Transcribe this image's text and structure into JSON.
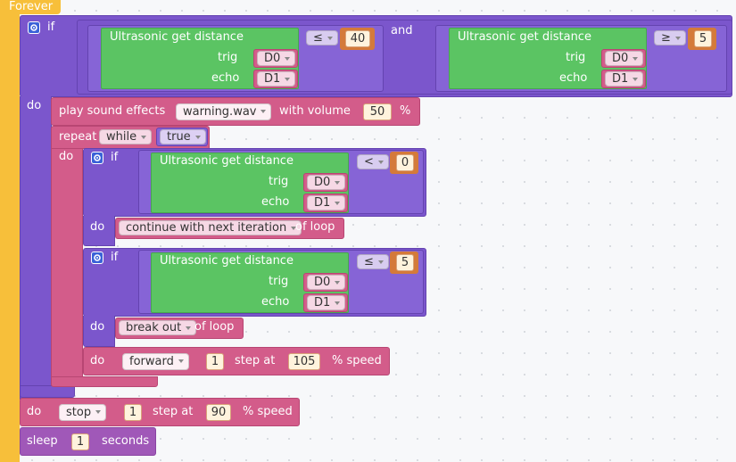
{
  "colors": {
    "event": "#f7bf3a",
    "logic": "#7b56cc",
    "sensor": "#5bc463",
    "action": "#d35c8a",
    "control": "#a058b8",
    "number_border": "#d47a3a"
  },
  "hat": {
    "label": "Forever"
  },
  "main_if": {
    "if_label": "if",
    "and_label": "and",
    "do_label": "do",
    "left": {
      "sensor_label": "Ultrasonic get distance",
      "trig_label": "trig",
      "trig_pin": "D0",
      "echo_label": "echo",
      "echo_pin": "D1",
      "operator": "≤",
      "value": "40"
    },
    "right": {
      "sensor_label": "Ultrasonic get distance",
      "trig_label": "trig",
      "trig_pin": "D0",
      "echo_label": "echo",
      "echo_pin": "D1",
      "operator": "≥",
      "value": "5"
    }
  },
  "play_sound": {
    "prefix": "play sound effects",
    "file": "warning.wav",
    "middle": "with volume",
    "volume": "50",
    "suffix": "%"
  },
  "repeat": {
    "label": "repeat",
    "mode": "while",
    "condition": "true",
    "do_label": "do"
  },
  "inner_if_1": {
    "if_label": "if",
    "do_label": "do",
    "sensor_label": "Ultrasonic get distance",
    "trig_label": "trig",
    "trig_pin": "D0",
    "echo_label": "echo",
    "echo_pin": "D1",
    "operator": "<",
    "value": "0",
    "action": "continue with next iteration",
    "action_suffix": "of loop"
  },
  "inner_if_2": {
    "if_label": "if",
    "do_label": "do",
    "sensor_label": "Ultrasonic get distance",
    "trig_label": "trig",
    "trig_pin": "D0",
    "echo_label": "echo",
    "echo_pin": "D1",
    "operator": "≤",
    "value": "5",
    "action": "break out",
    "action_suffix": "of loop"
  },
  "move_forward": {
    "do_label": "do",
    "direction": "forward",
    "steps": "1",
    "step_label": "step at",
    "speed": "105",
    "speed_label": "% speed"
  },
  "move_stop": {
    "do_label": "do",
    "direction": "stop",
    "steps": "1",
    "step_label": "step at",
    "speed": "90",
    "speed_label": "% speed"
  },
  "sleep": {
    "label": "sleep",
    "value": "1",
    "unit": "seconds"
  }
}
